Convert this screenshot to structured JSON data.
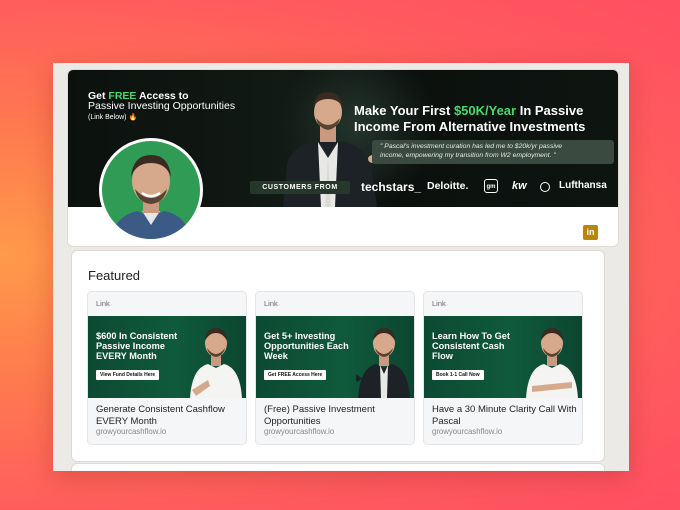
{
  "banner": {
    "left_line1_prefix": "Get ",
    "left_line1_highlight": "FREE",
    "left_line1_suffix": " Access to",
    "left_line2": "Passive Investing Opportunities",
    "left_line3": "(Link Below)",
    "left_line3_emoji": "🔥",
    "headline_prefix": "Make Your First ",
    "headline_highlight": "$50K/Year",
    "headline_suffix": " In Passive",
    "headline_line2": "Income From Alternative Investments",
    "quote_line1": "\" Pascal's investment curation has led me to $20k/yr passive",
    "quote_line2": "income, empowering my transition from W2 employment. \"",
    "customers_label": "CUSTOMERS FROM",
    "logos": [
      "techstars_",
      "Deloitte.",
      "gm",
      "kw",
      "Lufthansa"
    ]
  },
  "profile": {
    "linkedin_badge": "in"
  },
  "featured": {
    "title": "Featured",
    "items": [
      {
        "tag": "Link",
        "image_headline": "$600 In Consistent Passive Income EVERY Month",
        "image_cta": "View Fund Details Here",
        "description": "Generate Consistent Cashflow EVERY Month",
        "domain": "growyourcashflow.io"
      },
      {
        "tag": "Link",
        "image_headline": "Get 5+ Investing Opportunities Each Week",
        "image_cta": "Get FREE Access Here",
        "description": "(Free) Passive Investment Opportunities",
        "domain": "growyourcashflow.io"
      },
      {
        "tag": "Link",
        "image_headline": "Learn How To Get Consistent Cash Flow",
        "image_cta": "Book 1-1 Call Now",
        "description": "Have a 30 Minute Clarity Call With Pascal",
        "domain": "growyourcashflow.io"
      }
    ]
  },
  "colors": {
    "accent_green": "#49d86a",
    "linkedin_gold": "#b8860b",
    "banner_bg": "#0c110e",
    "featured_image_bg": "#0f5a3d"
  }
}
